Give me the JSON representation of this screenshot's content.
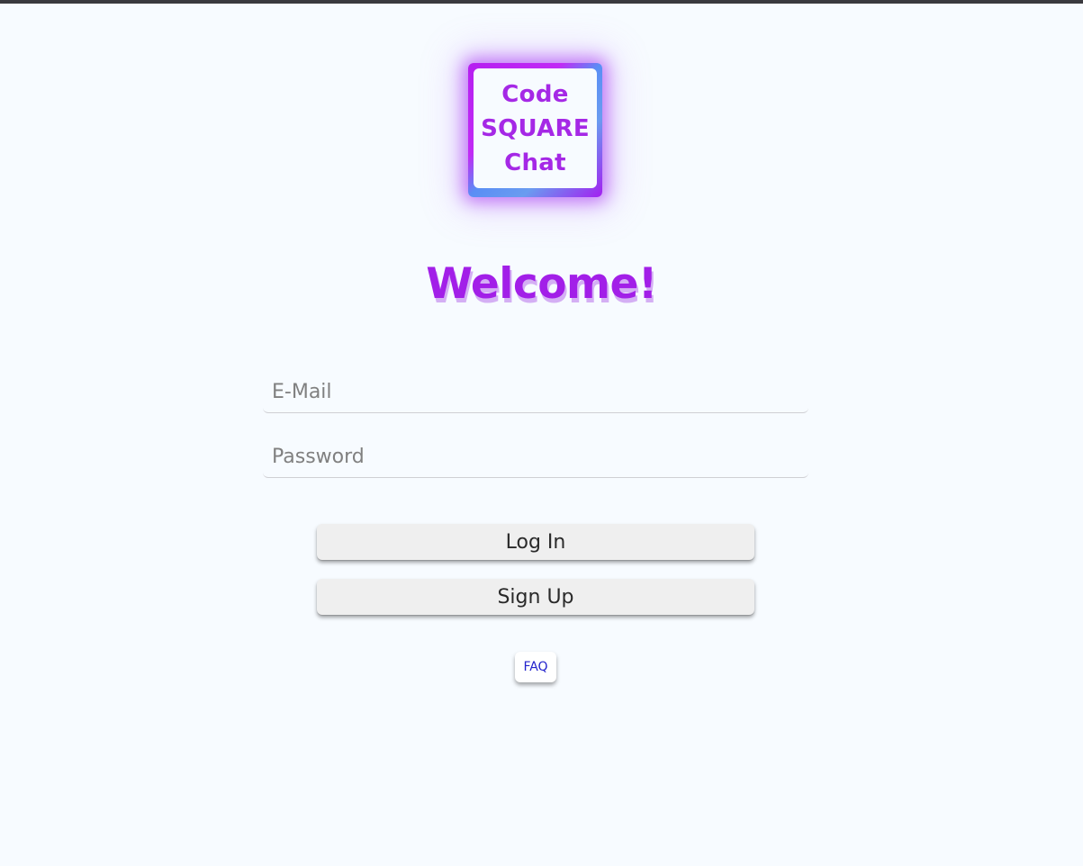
{
  "logo": {
    "lines": [
      "Code",
      "SQUARE",
      "Chat"
    ],
    "icon": "code-square-chat-logo"
  },
  "welcome": {
    "title": "Welcome!"
  },
  "form": {
    "email_placeholder": "E-Mail",
    "email_value": "",
    "password_placeholder": "Password",
    "password_value": ""
  },
  "buttons": {
    "login_label": "Log In",
    "signup_label": "Sign Up",
    "faq_label": "FAQ"
  },
  "colors": {
    "background": "#f7fbff",
    "brand_purple": "#a21fe8",
    "faq_link": "#2222cc",
    "button_bg": "#efefef"
  }
}
